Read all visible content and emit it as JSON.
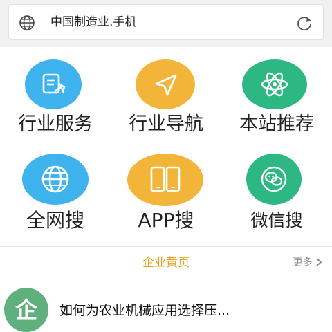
{
  "address_bar": {
    "url_text": "中国制造业.手机",
    "globe_icon": "globe-icon",
    "reload_icon": "reload-icon"
  },
  "tiles": [
    {
      "label": "行业服务",
      "icon": "document-edit-icon",
      "color": "#3fb3ee"
    },
    {
      "label": "行业导航",
      "icon": "navigation-arrow-icon",
      "color": "#f2b53a"
    },
    {
      "label": "本站推荐",
      "icon": "atom-icon",
      "color": "#2db883"
    },
    {
      "label": "全网搜",
      "icon": "globe-icon",
      "color": "#3fb3ee"
    },
    {
      "label": "APP搜",
      "icon": "phones-icon",
      "color": "#f2b53a"
    },
    {
      "label": "微信搜",
      "icon": "wechat-icon",
      "color": "#2db883"
    }
  ],
  "section": {
    "title": "企业黄页",
    "more_label": "更多",
    "more_icon": "chevron-right-icon",
    "accent": "#e0a41e"
  },
  "news": {
    "badge_text": "企",
    "title": "如何为农业机械应用选择压..."
  }
}
